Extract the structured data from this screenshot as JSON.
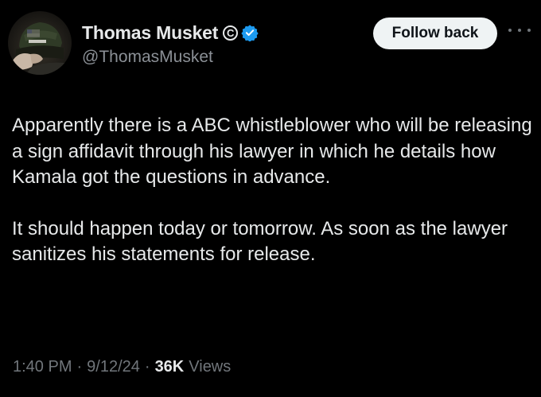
{
  "author": {
    "display_name": "Thomas Musket",
    "badge_text": "C",
    "handle": "@ThomasMusket",
    "verified_color": "#1d9bf0"
  },
  "actions": {
    "follow_label": "Follow back",
    "more_icon": "more-horizontal-icon"
  },
  "tweet": {
    "paragraphs": [
      "Apparently there is a ABC whistleblower who will be releasing a sign affidavit through his lawyer in which he details how Kamala got the questions in advance.",
      "It should happen today or tomorrow. As soon as the lawyer sanitizes his statements for release."
    ]
  },
  "meta": {
    "time": "1:40 PM",
    "separator": "·",
    "date": "9/12/24",
    "views_count": "36K",
    "views_label": "Views"
  }
}
